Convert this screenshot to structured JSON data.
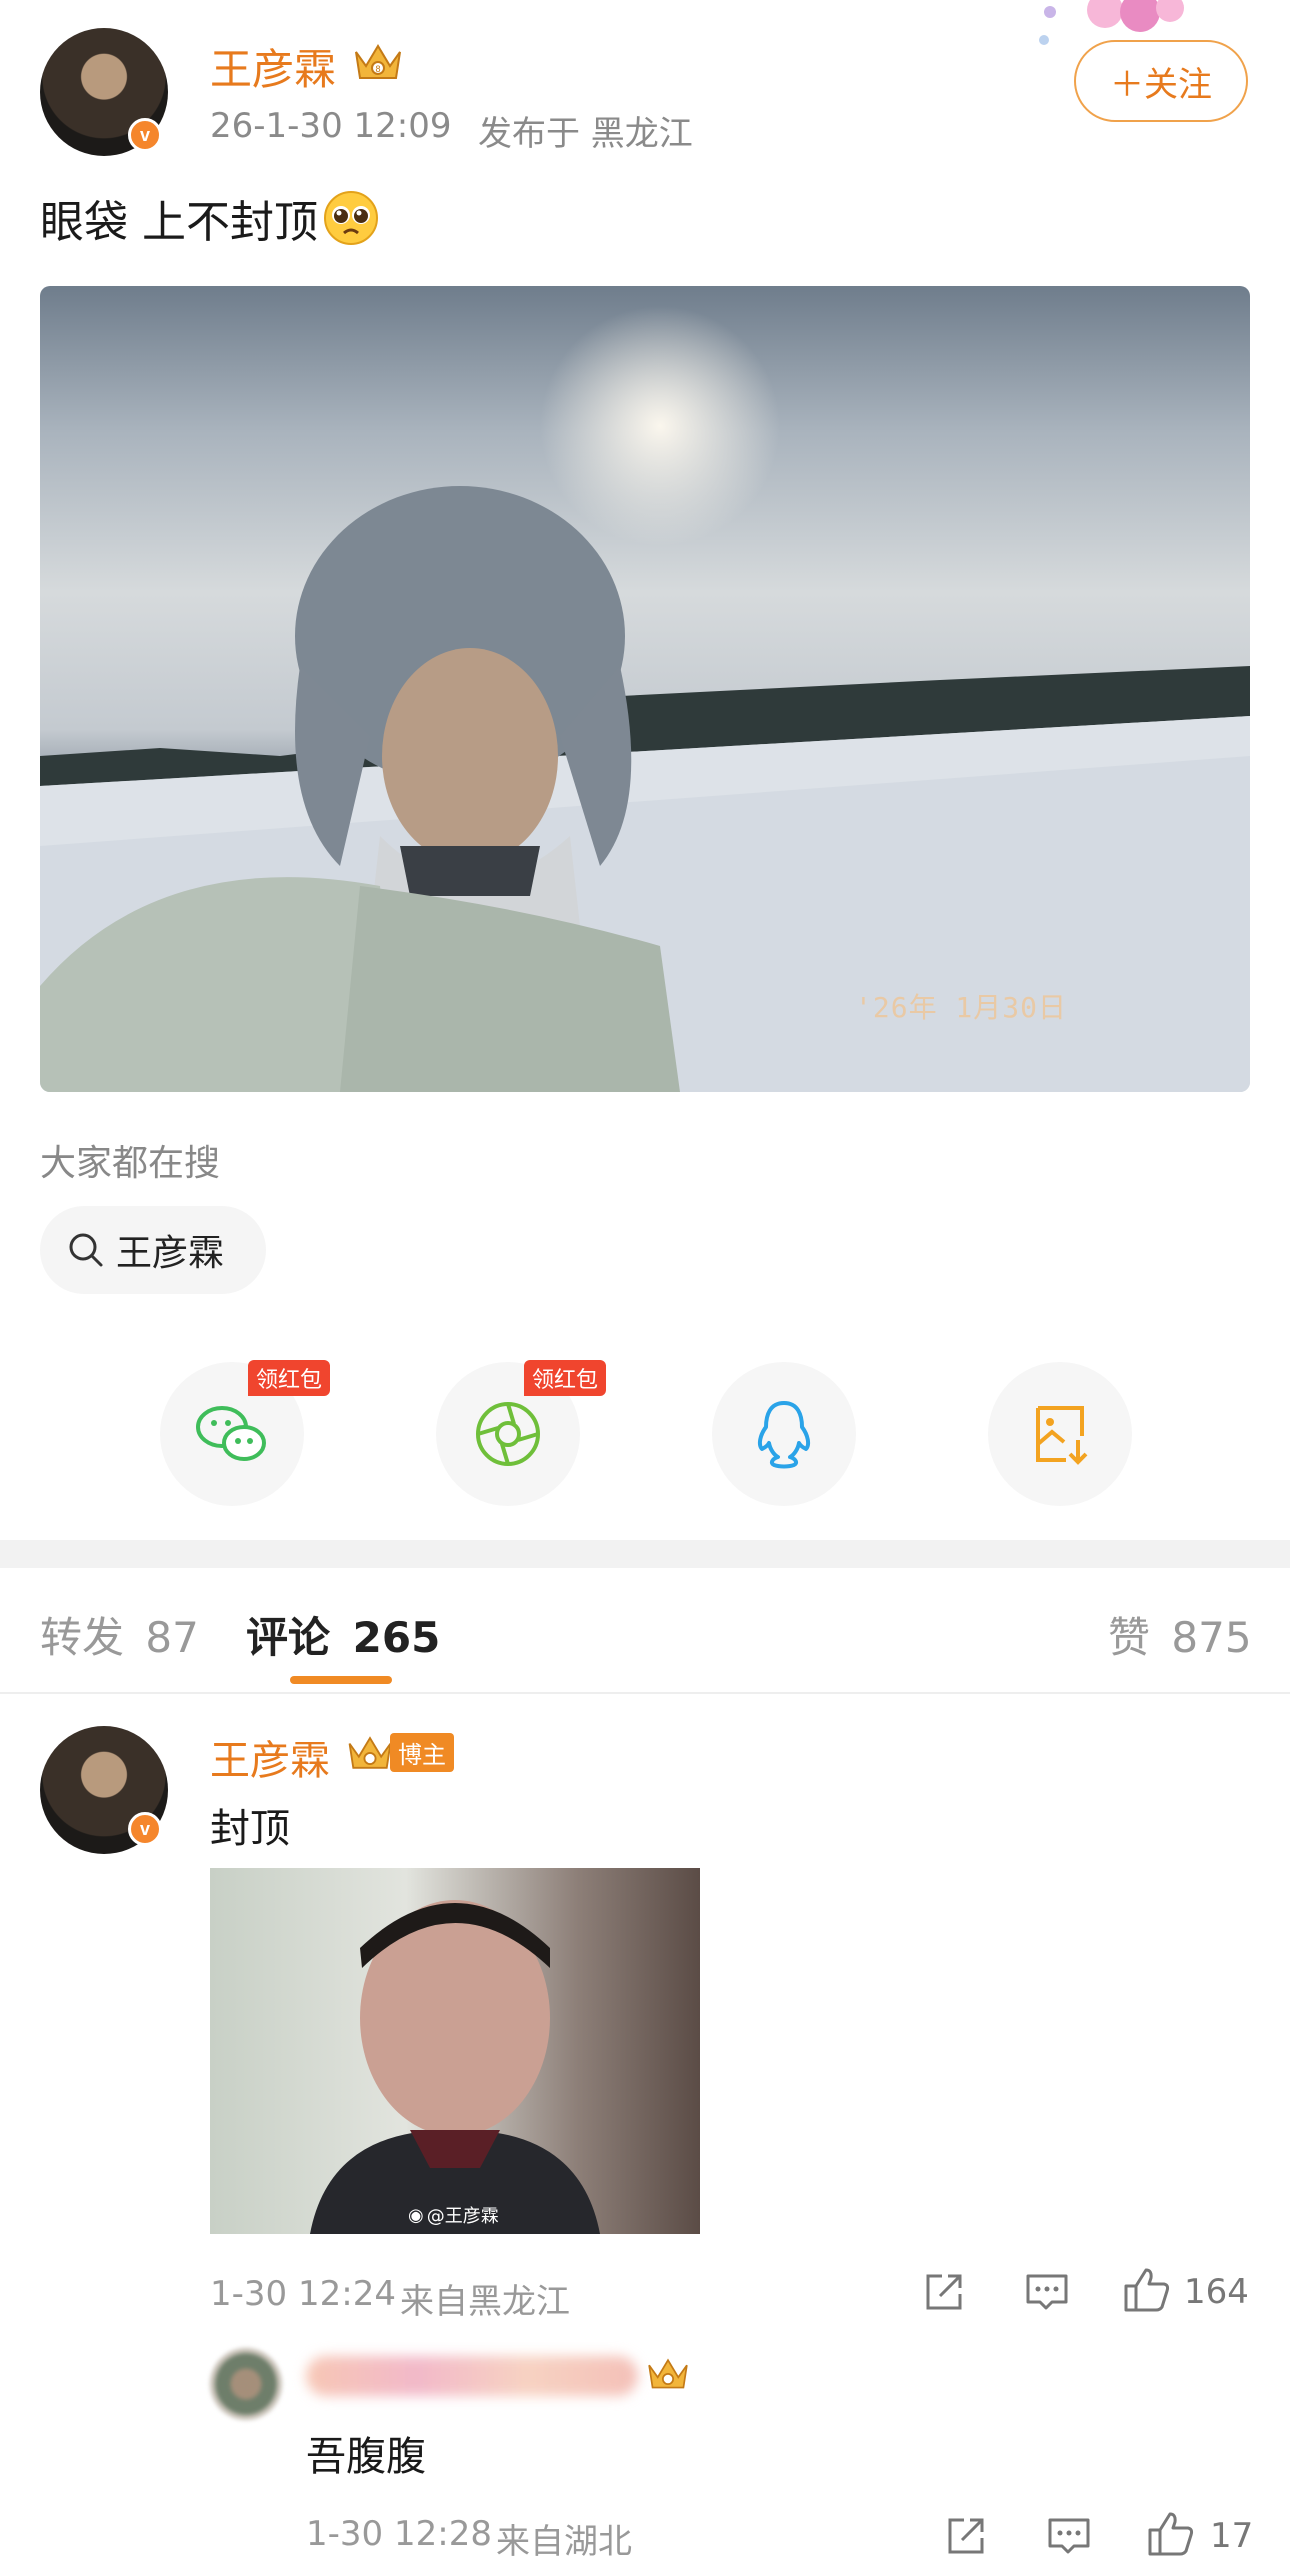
{
  "post": {
    "author": "王彦霖",
    "time": "26-1-30 12:09",
    "location": "发布于 黑龙江",
    "follow_label": "＋关注",
    "text": "眼袋 上不封顶",
    "emoji": "🥺",
    "photo_stamp": "'26年 1月30日",
    "photo_watermark_icon": "camera-photo"
  },
  "hot_search": {
    "title": "大家都在搜",
    "keyword": "王彦霖"
  },
  "share": {
    "items": [
      {
        "name": "wechat",
        "tag": "领红包",
        "color": "#3fbd5a"
      },
      {
        "name": "moments",
        "tag": "领红包",
        "color": "#6fbf3a"
      },
      {
        "name": "qq",
        "tag": "",
        "color": "#2aa3e8"
      },
      {
        "name": "save-image",
        "tag": "",
        "color": "#f3a320"
      }
    ]
  },
  "tabs": {
    "repost_label": "转发",
    "repost_count": "87",
    "comment_label": "评论",
    "comment_count": "265",
    "like_label": "赞",
    "like_count": "875"
  },
  "comment": {
    "author": "王彦霖",
    "badge": "博主",
    "text": "封顶",
    "image_watermark": "@王彦霖",
    "time": "1-30 12:24",
    "location": "来自黑龙江",
    "likes": "164"
  },
  "reply": {
    "text": "吾腹腹",
    "time": "1-30 12:28",
    "location": "来自湖北",
    "likes": "17"
  },
  "colors": {
    "accent": "#e77a1d",
    "tab_underline": "#f08a24",
    "red_tag": "#f0452e"
  }
}
